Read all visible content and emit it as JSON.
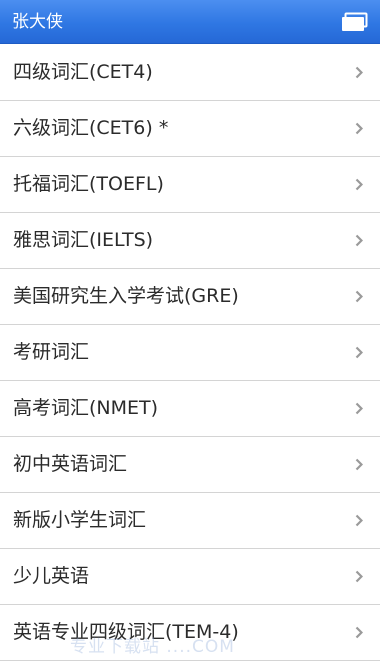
{
  "titlebar": {
    "title": "张大侠",
    "window_icon": "windows-icon"
  },
  "list": {
    "items": [
      {
        "label": "四级词汇(CET4)"
      },
      {
        "label": "六级词汇(CET6) *"
      },
      {
        "label": "托福词汇(TOEFL)"
      },
      {
        "label": "雅思词汇(IELTS)"
      },
      {
        "label": "美国研究生入学考试(GRE)"
      },
      {
        "label": "考研词汇"
      },
      {
        "label": "高考词汇(NMET)"
      },
      {
        "label": "初中英语词汇"
      },
      {
        "label": "新版小学生词汇"
      },
      {
        "label": "少儿英语"
      },
      {
        "label": "英语专业四级词汇(TEM-4)"
      }
    ],
    "chevron_icon": "chevron-right-icon"
  },
  "watermark": {
    "text": "专业下载站 ....COM"
  },
  "colors": {
    "titlebar": "#2f77e3",
    "divider": "#d4d4d4",
    "text": "#2b2b2b",
    "chevron": "#9a9a9a"
  }
}
